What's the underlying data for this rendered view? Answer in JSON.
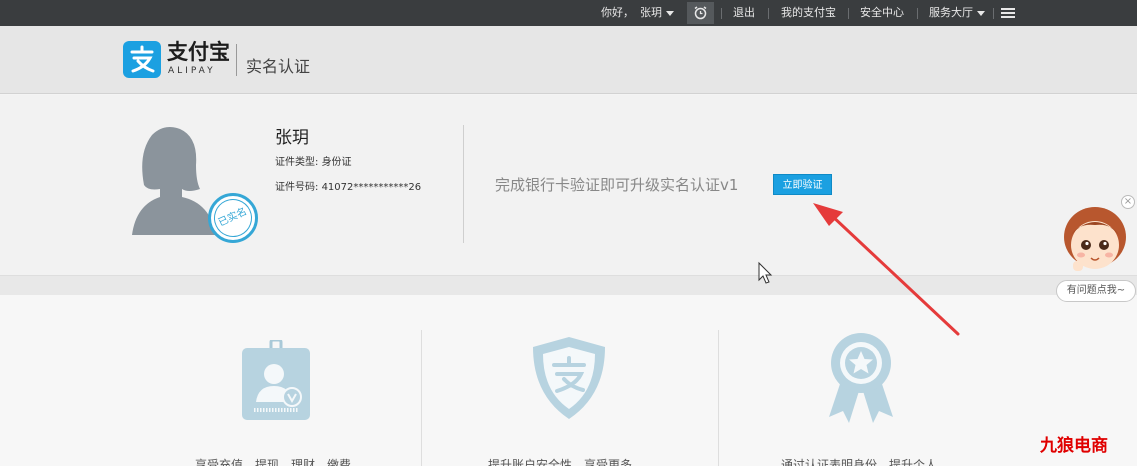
{
  "topbar": {
    "greeting": "你好，",
    "username": "张玥",
    "logout": "退出",
    "my_alipay": "我的支付宝",
    "security_center": "安全中心",
    "service_hall": "服务大厅"
  },
  "header": {
    "logo_cn": "支付宝",
    "logo_en": "ALIPAY",
    "subtitle": "实名认证"
  },
  "profile": {
    "name": "张玥",
    "id_type_label": "证件类型:",
    "id_type_value": "身份证",
    "id_number_label": "证件号码:",
    "id_number_value": "41072***********26",
    "verified_stamp": "已实名",
    "verify_prompt": "完成银行卡验证即可升级实名认证v1",
    "verify_button": "立即验证"
  },
  "features": [
    {
      "icon": "id-card-icon",
      "caption": "享受充值、提现、理财、缴费"
    },
    {
      "icon": "shield-icon",
      "caption": "提升账户安全性，享受更多"
    },
    {
      "icon": "award-ribbon-icon",
      "caption": "通过认证表明身份，提升个人"
    }
  ],
  "assistant": {
    "tip": "有问题点我~",
    "close": "×"
  },
  "watermark": "九狼电商",
  "colors": {
    "accent": "#1ba0e1",
    "topbar": "#3a3d3f",
    "annotation_arrow": "#e53b3b",
    "watermark": "#e00000"
  }
}
